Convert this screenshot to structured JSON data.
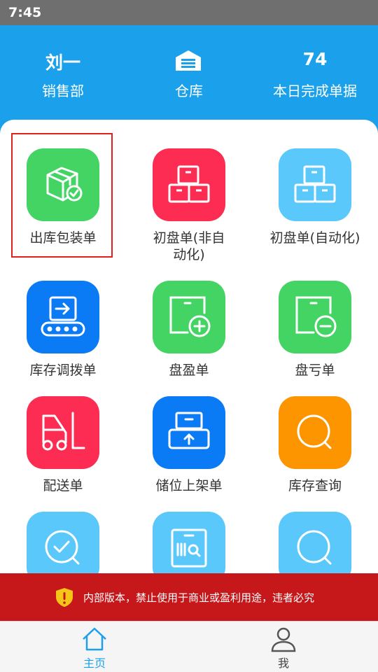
{
  "status_bar": {
    "time": "7:45"
  },
  "header": {
    "user_name": "刘一",
    "department": "销售部",
    "warehouse_label": "仓库",
    "completed_count": "74",
    "completed_label": "本日完成单据"
  },
  "tiles": [
    {
      "label": "出库包装单",
      "color": "#43d463",
      "icon": "package-check-icon"
    },
    {
      "label": "初盘单(非自动化)",
      "color": "#fd2c52",
      "icon": "boxes-icon"
    },
    {
      "label": "初盘单(自动化)",
      "color": "#5ac8fa",
      "icon": "boxes-icon"
    },
    {
      "label": "库存调拨单",
      "color": "#0a7bf5",
      "icon": "conveyor-transfer-icon"
    },
    {
      "label": "盘盈单",
      "color": "#43d463",
      "icon": "box-plus-icon"
    },
    {
      "label": "盘亏单",
      "color": "#43d463",
      "icon": "box-minus-icon"
    },
    {
      "label": "配送单",
      "color": "#fd2c52",
      "icon": "forklift-icon"
    },
    {
      "label": "储位上架单",
      "color": "#0a7bf5",
      "icon": "shelf-upload-icon"
    },
    {
      "label": "库存查询",
      "color": "#fd9500",
      "icon": "search-icon"
    },
    {
      "label": "",
      "color": "#5ac8fa",
      "icon": "search-check-icon"
    },
    {
      "label": "",
      "color": "#5ac8fa",
      "icon": "barcode-scan-icon"
    },
    {
      "label": "",
      "color": "#5ac8fa",
      "icon": "search-icon"
    }
  ],
  "warning": {
    "text": "内部版本，禁止使用于商业或盈利用途，违者必究"
  },
  "tabbar": {
    "home_label": "主页",
    "me_label": "我"
  }
}
